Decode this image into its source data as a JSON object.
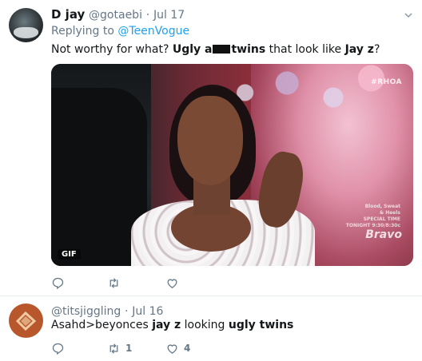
{
  "tweets": [
    {
      "name": "D jay",
      "handle": "@gotaebi",
      "separator": "·",
      "time": "Jul 17",
      "replying_prefix": "Replying to ",
      "replying_to": "@TeenVogue",
      "text_parts": [
        "Not worthy for what? ",
        "Ugly a",
        "twins",
        " that look like ",
        "Jay z",
        "?"
      ],
      "media": {
        "watermark_tag": "#RHOA",
        "watermark_lines": [
          "Blood, Sweat",
          "& Heels",
          "SPECIAL TIME",
          "TONIGHT 9:30/8:30c"
        ],
        "watermark_logo": "Bravo",
        "gif_badge": "GIF"
      },
      "actions": {
        "reply_icon": "reply-icon",
        "retweet_icon": "retweet-icon",
        "like_icon": "heart-icon",
        "reply_count": "",
        "retweet_count": "",
        "like_count": ""
      }
    },
    {
      "name": "",
      "handle": "@titsjiggling",
      "separator": "·",
      "time": "Jul 16",
      "text_parts": [
        "Asahd>beyonces ",
        "jay z",
        " looking ",
        "ugly twins"
      ],
      "actions": {
        "reply_icon": "reply-icon",
        "retweet_icon": "retweet-icon",
        "like_icon": "heart-icon",
        "reply_count": "",
        "retweet_count": "1",
        "like_count": "4"
      }
    }
  ],
  "colors": {
    "link": "#1da1f2",
    "muted": "#657786",
    "text": "#14171a",
    "divider": "#e6ecf0"
  }
}
